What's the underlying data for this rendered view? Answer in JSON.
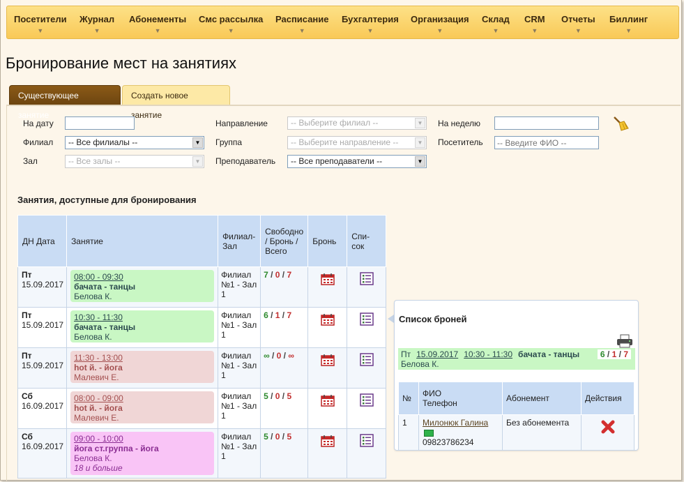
{
  "menu": {
    "items": [
      {
        "label": "Посетители"
      },
      {
        "label": "Журнал"
      },
      {
        "label": "Абонементы"
      },
      {
        "label": "Смс рассылка"
      },
      {
        "label": "Расписание"
      },
      {
        "label": "Бухгалтерия"
      },
      {
        "label": "Организация"
      },
      {
        "label": "Склад"
      },
      {
        "label": "CRM"
      },
      {
        "label": "Отчеты"
      },
      {
        "label": "Биллинг"
      }
    ],
    "arrow": "▼"
  },
  "page": {
    "title": "Бронирование мест на занятиях"
  },
  "tabs": {
    "existing": "Существующее занятие",
    "create": "Создать новое занятие"
  },
  "filters": {
    "date_label": "На дату",
    "date_value": "",
    "branch_label": "Филиал",
    "branch_value": "-- Все филиалы --",
    "hall_label": "Зал",
    "hall_value": "-- Все залы --",
    "direction_label": "Направление",
    "direction_value": "-- Выберите филиал --",
    "group_label": "Группа",
    "group_value": "-- Выберите направление --",
    "teacher_label": "Преподаватель",
    "teacher_value": "-- Все преподаватели --",
    "week_label": "На неделю",
    "week_value": "",
    "visitor_label": "Посетитель",
    "visitor_placeholder": "-- Введите ФИО --"
  },
  "classes": {
    "section_title": "Занятия, доступные для бронирования",
    "headers": {
      "day_date": "ДН Дата",
      "lesson": "Занятие",
      "branch_hall": "Филиал-Зал",
      "free_booked_total": "Свободно / Бронь / Всего",
      "booking": "Бронь",
      "list": "Спи-сок"
    },
    "rows": [
      {
        "day": "Пт",
        "date": "15.09.2017",
        "time": "08:00 - 09:30",
        "name": "бачата - танцы",
        "teacher": "Белова К.",
        "note": "",
        "color": "green",
        "branch": "Филиал №1 - Зал 1",
        "free": "7",
        "booked": "0",
        "total": "7"
      },
      {
        "day": "Пт",
        "date": "15.09.2017",
        "time": "10:30 - 11:30",
        "name": "бачата - танцы",
        "teacher": "Белова К.",
        "note": "",
        "color": "green",
        "branch": "Филиал №1 - Зал 1",
        "free": "6",
        "booked": "1",
        "total": "7"
      },
      {
        "day": "Пт",
        "date": "15.09.2017",
        "time": "11:30 - 13:00",
        "name": "hot й. - йога",
        "teacher": "Малевич Е.",
        "note": "",
        "color": "red",
        "branch": "Филиал №1 - Зал 1",
        "free": "∞",
        "booked": "0",
        "total": "∞"
      },
      {
        "day": "Сб",
        "date": "16.09.2017",
        "time": "08:00 - 09:00",
        "name": "hot й. - йога",
        "teacher": "Малевич Е.",
        "note": "",
        "color": "red",
        "branch": "Филиал №1 - Зал 1",
        "free": "5",
        "booked": "0",
        "total": "5"
      },
      {
        "day": "Сб",
        "date": "16.09.2017",
        "time": "09:00 - 10:00",
        "name": "йога ст.группа - йога",
        "teacher": "Белова К.",
        "note": "18 и больше",
        "color": "pink",
        "branch": "Филиал №1 - Зал 1",
        "free": "5",
        "booked": "0",
        "total": "5"
      }
    ]
  },
  "bookings": {
    "title": "Список броней",
    "summary": {
      "day": "Пт",
      "date": "15.09.2017",
      "time": "10:30 - 11:30",
      "name": "бачата - танцы",
      "teacher": "Белова К.",
      "free": "6",
      "booked": "1",
      "total": "7"
    },
    "headers": {
      "num": "№",
      "fio": "ФИО",
      "phone": "Телефон",
      "subscription": "Абонемент",
      "actions": "Действия"
    },
    "rows": [
      {
        "num": "1",
        "name": "Милонюк Галина",
        "phone": "09823786234",
        "subscription": "Без абонемента"
      }
    ]
  },
  "colors": {
    "menu_bg": "#f9c957",
    "active_tab": "#6d4510",
    "header_bg": "#c9dcf4",
    "green_lesson": "#c9f7c4",
    "red_lesson": "#f0d6d6",
    "pink_lesson": "#f9c4f6"
  }
}
